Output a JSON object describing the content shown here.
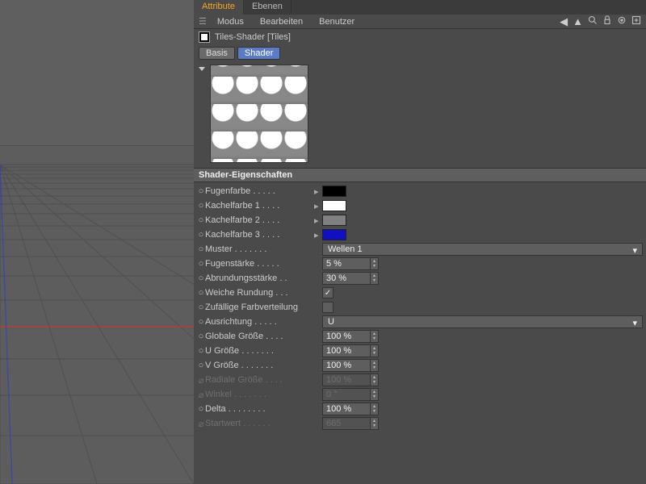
{
  "tabs": {
    "attribute": "Attribute",
    "ebenen": "Ebenen"
  },
  "menu": {
    "modus": "Modus",
    "bearbeiten": "Bearbeiten",
    "benutzer": "Benutzer"
  },
  "object": {
    "name": "Tiles-Shader [Tiles]"
  },
  "subtabs": {
    "basis": "Basis",
    "shader": "Shader"
  },
  "section": {
    "title": "Shader-Eigenschaften"
  },
  "props": {
    "fugenfarbe": {
      "label": "Fugenfarbe",
      "color": "#000000"
    },
    "kachelfarbe1": {
      "label": "Kachelfarbe 1",
      "color": "#ffffff"
    },
    "kachelfarbe2": {
      "label": "Kachelfarbe 2",
      "color": "#808080"
    },
    "kachelfarbe3": {
      "label": "Kachelfarbe 3",
      "color": "#1010c0"
    },
    "muster": {
      "label": "Muster",
      "value": "Wellen 1"
    },
    "fugenstaerke": {
      "label": "Fugenstärke",
      "value": "5 %"
    },
    "abrundungsstaerke": {
      "label": "Abrundungsstärke",
      "value": "30 %"
    },
    "weiche_rundung": {
      "label": "Weiche Rundung",
      "checked": true
    },
    "zufall": {
      "label": "Zufällige Farbverteilung",
      "checked": false
    },
    "ausrichtung": {
      "label": "Ausrichtung",
      "value": "U"
    },
    "globale_groesse": {
      "label": "Globale Größe",
      "value": "100 %"
    },
    "u_groesse": {
      "label": "U Größe",
      "value": "100 %"
    },
    "v_groesse": {
      "label": "V Größe",
      "value": "100 %"
    },
    "radiale_groesse": {
      "label": "Radiale Größe",
      "value": "100 %"
    },
    "winkel": {
      "label": "Winkel",
      "value": "0 °"
    },
    "delta": {
      "label": "Delta",
      "value": "100 %"
    },
    "startwert": {
      "label": "Startwert",
      "value": "665"
    }
  }
}
